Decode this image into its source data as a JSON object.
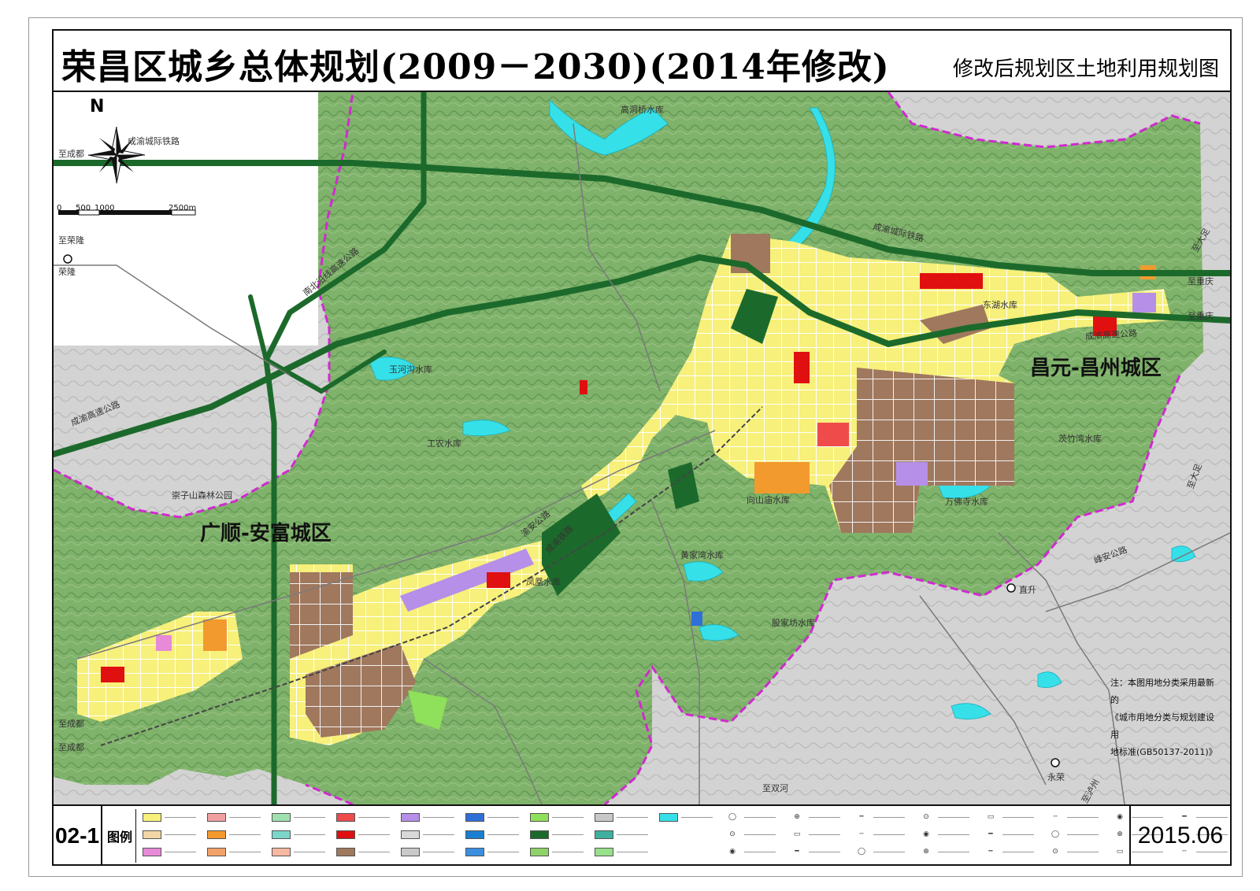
{
  "title": "荣昌区城乡总体规划(2009－2030)(2014年修改)",
  "subtitle": "修改后规划区土地利用规划图",
  "sheet_number": "02-1",
  "legend_label": "图例",
  "date": "2015.06",
  "north_label": "N",
  "scale": {
    "ticks": [
      "0",
      "500",
      "1000",
      "2500m"
    ]
  },
  "districts": [
    {
      "label": "昌元-昌州城区"
    },
    {
      "label": "广顺-安富城区"
    }
  ],
  "places": [
    "荣隆",
    "直升",
    "永荣"
  ],
  "road_labels": [
    "成渝城际铁路",
    "成渝高速公路",
    "成渝高速公路",
    "南北沿线高速公路",
    "成渝城际铁路",
    "渝安公路",
    "峰安公路",
    "成渝铁路",
    "至成都",
    "至成都",
    "至成都",
    "至荣隆",
    "至大足",
    "至大足",
    "至重庆",
    "至重庆",
    "至泸州",
    "至双河"
  ],
  "water_labels": [
    "高洞桥水库",
    "东湖水库",
    "玉河沟水库",
    "工农水库",
    "凤凰水库",
    "向山庙水库",
    "万佛寺水库",
    "黄家湾水库",
    "股家坊水库",
    "茨竹湾水库",
    "崇子山森林公园"
  ],
  "note": {
    "line1": "注：本图用地分类采用最新的",
    "line2": "《城市用地分类与规划建设用",
    "line3": "地标准(GB50137-2011)》"
  },
  "legend": {
    "colors": [
      {
        "color": "#f7f07a"
      },
      {
        "color": "#f2d6a6"
      },
      {
        "color": "#e78ad8"
      },
      {
        "color": "#f0a0a0"
      },
      {
        "color": "#f29a2e"
      },
      {
        "color": "#f3a26a"
      },
      {
        "color": "#9fe0b0"
      },
      {
        "color": "#7bd6c9"
      },
      {
        "color": "#f7b8a0"
      },
      {
        "color": "#ef4b4b"
      },
      {
        "color": "#e01010"
      },
      {
        "color": "#a0785e"
      },
      {
        "color": "#b68fe8"
      },
      {
        "color": "#d8d8d8"
      },
      {
        "color": "#c9c9c9"
      },
      {
        "color": "#2f6fd8"
      },
      {
        "color": "#1a7fd0"
      },
      {
        "color": "#3b8fe0"
      },
      {
        "color": "#8fe05a"
      },
      {
        "color": "#1c6a2b"
      },
      {
        "color": "#8ed26a"
      },
      {
        "color": "#c8c8c8"
      },
      {
        "color": "#3fb0a0"
      },
      {
        "color": "#98e08a"
      },
      {
        "color": "#36e0e8"
      }
    ]
  },
  "palette": {
    "terrain_green": "#7fb26a",
    "urban_yellow": "#f7f07a",
    "industrial_brown": "#a0785e",
    "highway_green": "#1c6a2b",
    "water_cyan": "#36e0e8",
    "boundary_magenta": "#d02ad0"
  }
}
